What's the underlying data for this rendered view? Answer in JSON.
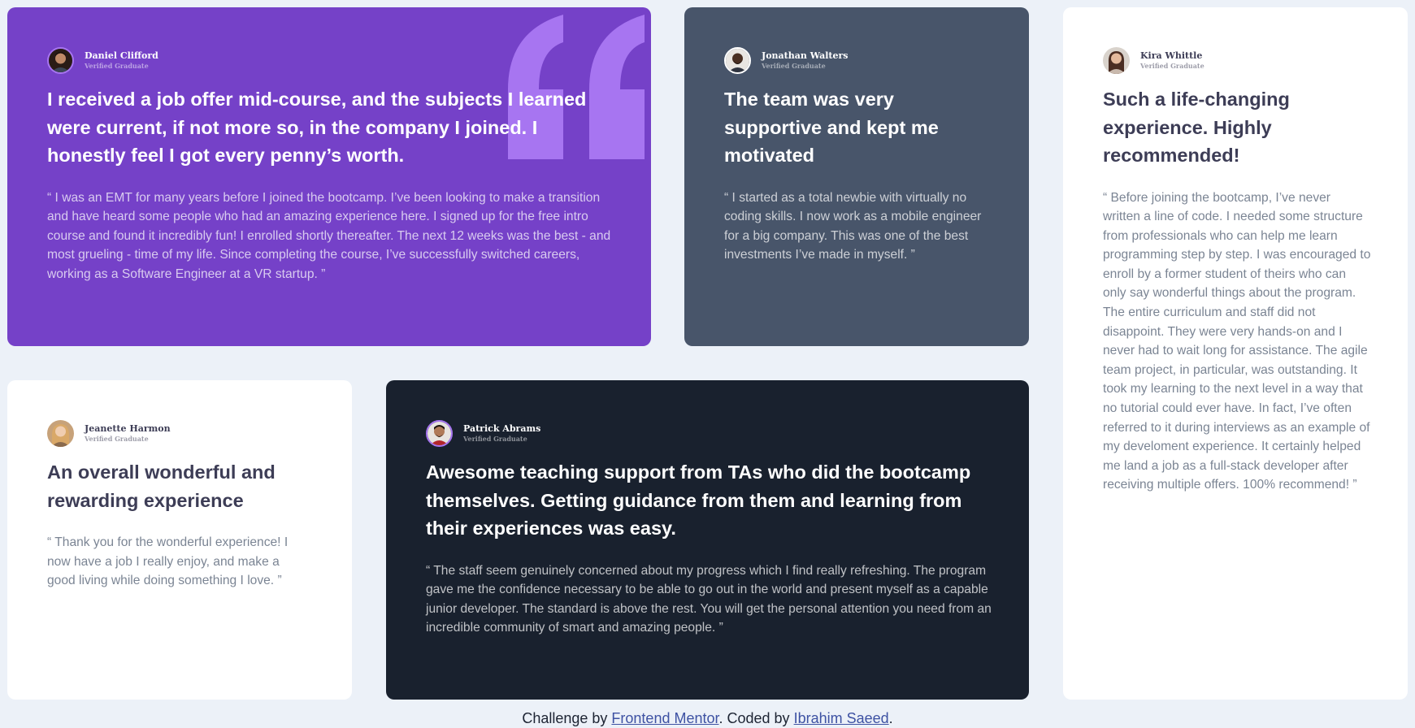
{
  "colors": {
    "page_background": "#ecf1f8",
    "purple_card": "#7541c8",
    "grayish_blue_card": "#48556a",
    "white_card": "#ffffff",
    "dark_card": "#19212e",
    "quote_mark": "#a775f1",
    "link": "#3e52a3"
  },
  "testimonials": {
    "daniel": {
      "name": "Daniel Clifford",
      "role": "Verified Graduate",
      "avatar_icon": "person-avatar",
      "headline": "I received a job offer mid-course, and the subjects I learned were current, if not more so, in the company I joined. I honestly feel I got every penny’s worth.",
      "body": "“ I was an EMT for many years before I joined the bootcamp. I’ve been looking to make a transition and have heard some people who had an amazing experience here. I signed up for the free intro course and found it incredibly fun! I enrolled shortly thereafter. The next 12 weeks was the best - and most grueling - time of my life. Since completing the course, I’ve successfully switched careers, working as a Software Engineer at a VR startup. ”"
    },
    "jonathan": {
      "name": "Jonathan Walters",
      "role": "Verified Graduate",
      "avatar_icon": "person-avatar",
      "headline": "The team was very supportive and kept me motivated",
      "body": "“ I started as a total newbie with virtually no coding skills. I now work as a mobile engineer for a big company. This was one of the best investments I’ve made in myself. ”"
    },
    "kira": {
      "name": "Kira Whittle",
      "role": "Verified Graduate",
      "avatar_icon": "person-avatar",
      "headline": "Such a life-changing experience. Highly recommended!",
      "body": "“ Before joining the bootcamp, I’ve never written a line of code. I needed some structure from professionals who can help me learn programming step by step. I was encouraged to enroll by a former student of theirs who can only say wonderful things about the program. The entire curriculum and staff did not disappoint. They were very hands-on and I never had to wait long for assistance. The agile team project, in particular, was outstanding. It took my learning to the next level in a way that no tutorial could ever have. In fact, I’ve often referred to it during interviews as an example of my develoment experience. It certainly helped me land a job as a full-stack developer after receiving multiple offers. 100% recommend! ”"
    },
    "jeanette": {
      "name": "Jeanette Harmon",
      "role": "Verified Graduate",
      "avatar_icon": "person-avatar",
      "headline": "An overall wonderful and rewarding experience",
      "body": "“ Thank you for the wonderful experience! I now have a job I really enjoy, and make a good living while doing something I love. ”"
    },
    "patrick": {
      "name": "Patrick Abrams",
      "role": "Verified Graduate",
      "avatar_icon": "person-avatar",
      "headline": "Awesome teaching support from TAs who did the bootcamp themselves. Getting guidance from them and learning from their experiences was easy.",
      "body": "“ The staff seem genuinely concerned about my progress which I find really refreshing. The program gave me the confidence necessary to be able to go out in the world and present myself as a capable junior developer. The standard is above the rest. You will get the personal attention you need from an incredible community of smart and amazing people. ”"
    }
  },
  "attribution": {
    "prefix": "Challenge by",
    "challenge_link": "Frontend Mentor",
    "middle": ". Coded by",
    "author_link": "Ibrahim Saeed",
    "suffix": "."
  }
}
